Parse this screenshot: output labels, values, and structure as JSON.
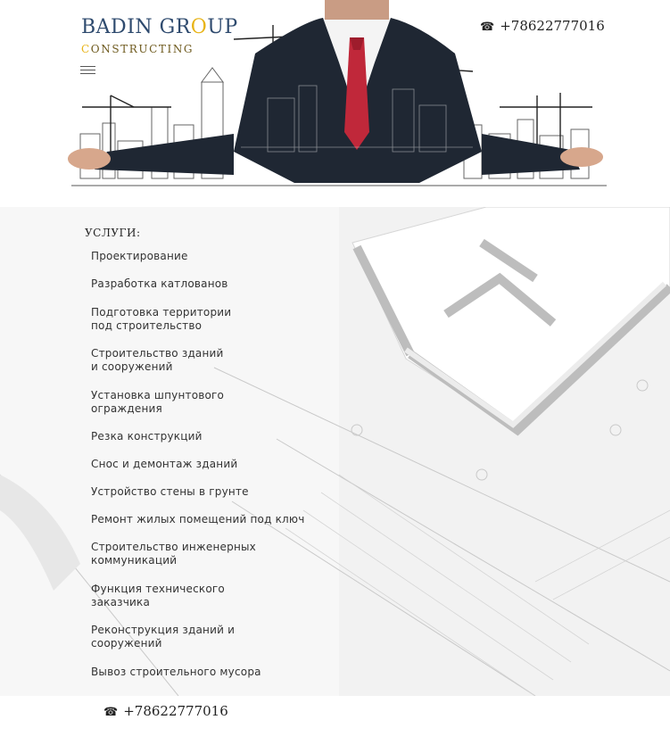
{
  "header": {
    "logo_title_1": "BADIN GR",
    "logo_title_o": "O",
    "logo_title_2": "UP",
    "logo_sub_c": "C",
    "logo_sub_rest": "ONSTRUCTING",
    "phone_icon": "☎",
    "phone": "+78622777016"
  },
  "services": {
    "heading": "УСЛУГИ:",
    "items": [
      "Проектирование",
      "Разработка катлованов",
      "Подготовка территории\n под строительство",
      "Строительство зданий\n и сооружений",
      "Установка шпунтового\n ограждения",
      "Резка конструкций",
      "Снос и демонтаж зданий",
      "Устройство стены в грунте",
      "Ремонт жилых помещений под ключ",
      "Строительство инженерных\n коммуникаций",
      "Функция технического\n заказчика",
      "Реконструкция зданий и\n сооружений",
      "Вывоз строительного мусора"
    ]
  },
  "footer": {
    "phone_icon": "☎",
    "phone": "+78622777016"
  },
  "colors": {
    "logo_blue": "#2e4a6e",
    "logo_accent": "#e8b418",
    "suit_dark": "#1f2733",
    "tie_red": "#c0283a"
  }
}
